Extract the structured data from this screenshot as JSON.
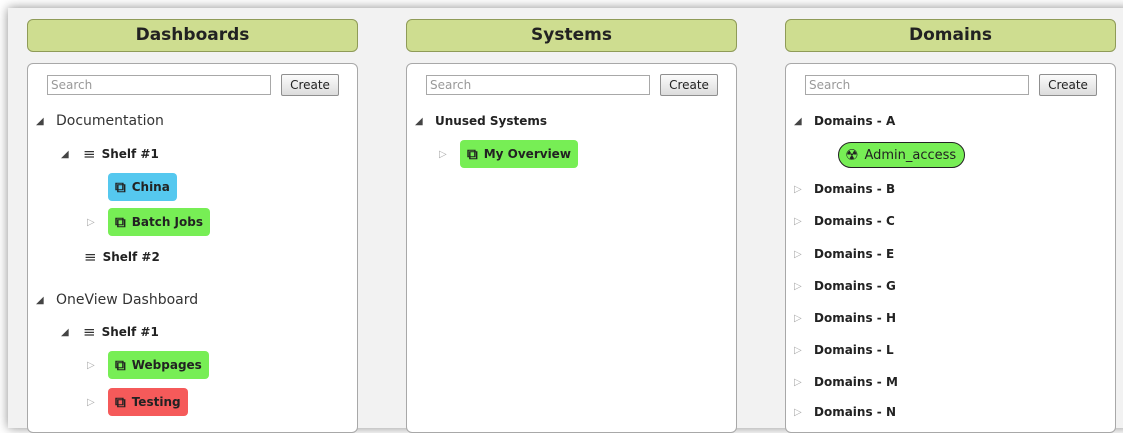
{
  "columns": {
    "dashboards": {
      "title": "Dashboards",
      "search_placeholder": "Search",
      "create_label": "Create",
      "tree": {
        "documentation": "Documentation",
        "doc_shelf1": "Shelf #1",
        "china": "China",
        "batch_jobs": "Batch Jobs",
        "doc_shelf2": "Shelf #2",
        "oneview": "OneView Dashboard",
        "ov_shelf1": "Shelf #1",
        "webpages": "Webpages",
        "testing": "Testing"
      }
    },
    "systems": {
      "title": "Systems",
      "search_placeholder": "Search",
      "create_label": "Create",
      "tree": {
        "unused": "Unused Systems",
        "my_overview": "My Overview"
      }
    },
    "domains": {
      "title": "Domains",
      "search_placeholder": "Search",
      "create_label": "Create",
      "tree": {
        "a": "Domains - A",
        "admin_access": "Admin_access",
        "b": "Domains - B",
        "c": "Domains - C",
        "e": "Domains - E",
        "g": "Domains - G",
        "h": "Domains - H",
        "l": "Domains - L",
        "m": "Domains - M",
        "n": "Domains - N"
      }
    }
  },
  "colors": {
    "header": "#cedd90",
    "tag_green": "#77ee55",
    "tag_cyan": "#55c8ef",
    "tag_red": "#f55a5a"
  },
  "icons": {
    "expanded": "triangle-down-icon",
    "collapsed": "triangle-right-icon",
    "shelf": "hamburger-lines-icon",
    "item": "copy-icon",
    "admin": "radiation-icon"
  }
}
